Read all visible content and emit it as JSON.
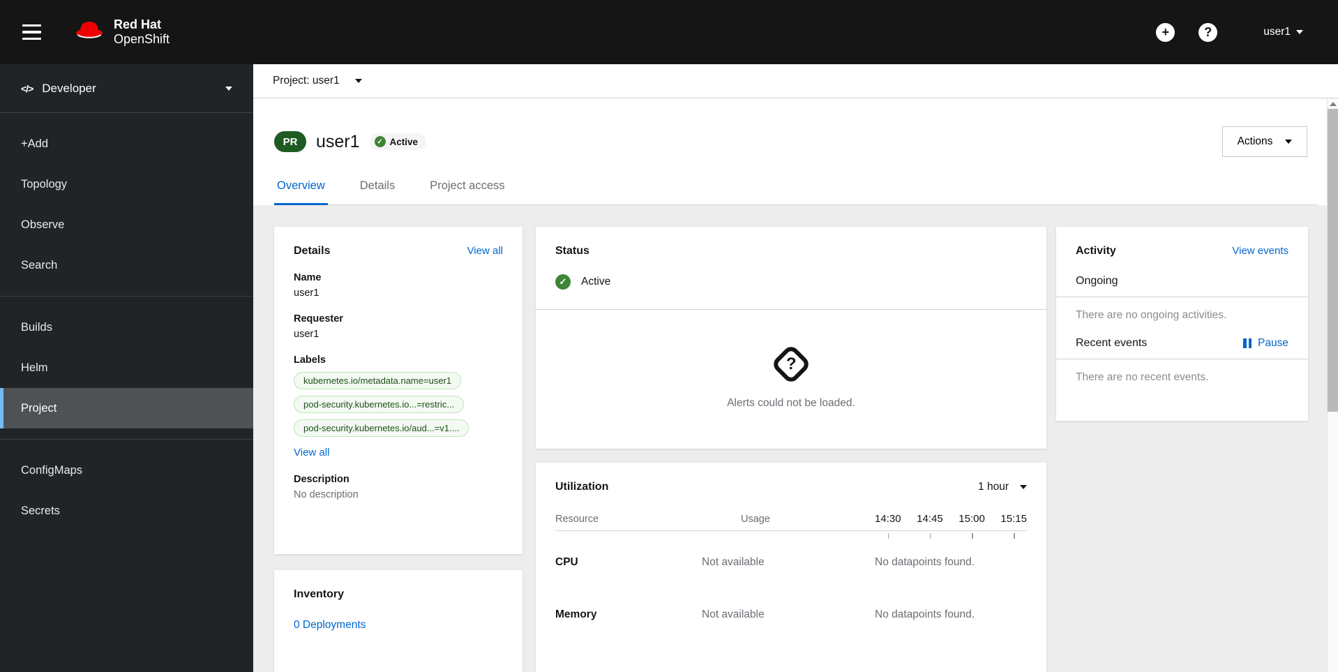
{
  "colors": {
    "accent_blue": "#0066cc",
    "success_green": "#3e8635",
    "project_badge_green": "#1e5b23",
    "nav_selected_border": "#73bcf7",
    "masthead_bg": "#151515",
    "sidebar_bg": "#212427"
  },
  "masthead": {
    "brand_line1": "Red Hat",
    "brand_line2": "OpenShift",
    "plus_glyph": "+",
    "help_glyph": "?",
    "username": "user1"
  },
  "sidebar": {
    "perspective": {
      "label": "Developer",
      "icon_glyph": "</>"
    },
    "sections": [
      {
        "items": [
          {
            "label": "+Add"
          },
          {
            "label": "Topology"
          },
          {
            "label": "Observe"
          },
          {
            "label": "Search"
          }
        ]
      },
      {
        "items": [
          {
            "label": "Builds"
          },
          {
            "label": "Helm"
          },
          {
            "label": "Project"
          }
        ]
      },
      {
        "items": [
          {
            "label": "ConfigMaps"
          },
          {
            "label": "Secrets"
          }
        ]
      }
    ]
  },
  "project_bar": {
    "label": "Project: user1"
  },
  "page_header": {
    "badge": "PR",
    "title": "user1",
    "status": "Active",
    "check_glyph": "✓",
    "actions_label": "Actions",
    "tabs": [
      {
        "label": "Overview"
      },
      {
        "label": "Details"
      },
      {
        "label": "Project access"
      }
    ]
  },
  "details_card": {
    "title": "Details",
    "view_all_link": "View all",
    "name_label": "Name",
    "name_value": "user1",
    "requester_label": "Requester",
    "requester_value": "user1",
    "labels_label": "Labels",
    "labels": [
      "kubernetes.io/metadata.name=user1",
      "pod-security.kubernetes.io...=restric...",
      "pod-security.kubernetes.io/aud...=v1...."
    ],
    "labels_view_all": "View all",
    "description_label": "Description",
    "description_value": "No description"
  },
  "status_card": {
    "title": "Status",
    "status": "Active",
    "check_glyph": "✓",
    "unknown_glyph": "?",
    "alerts_message": "Alerts could not be loaded."
  },
  "utilization_card": {
    "title": "Utilization",
    "duration": "1 hour",
    "resource_col": "Resource",
    "usage_col": "Usage",
    "times": [
      "14:30",
      "14:45",
      "15:00",
      "15:15"
    ],
    "rows": [
      {
        "resource": "CPU",
        "usage": "Not available",
        "datapoints": "No datapoints found."
      },
      {
        "resource": "Memory",
        "usage": "Not available",
        "datapoints": "No datapoints found."
      }
    ]
  },
  "activity_card": {
    "title": "Activity",
    "view_events_link": "View events",
    "ongoing_label": "Ongoing",
    "ongoing_empty": "There are no ongoing activities.",
    "recent_label": "Recent events",
    "pause_label": "Pause",
    "recent_empty": "There are no recent events."
  },
  "inventory_card": {
    "title": "Inventory",
    "links": [
      {
        "label": "0 Deployments"
      }
    ]
  }
}
